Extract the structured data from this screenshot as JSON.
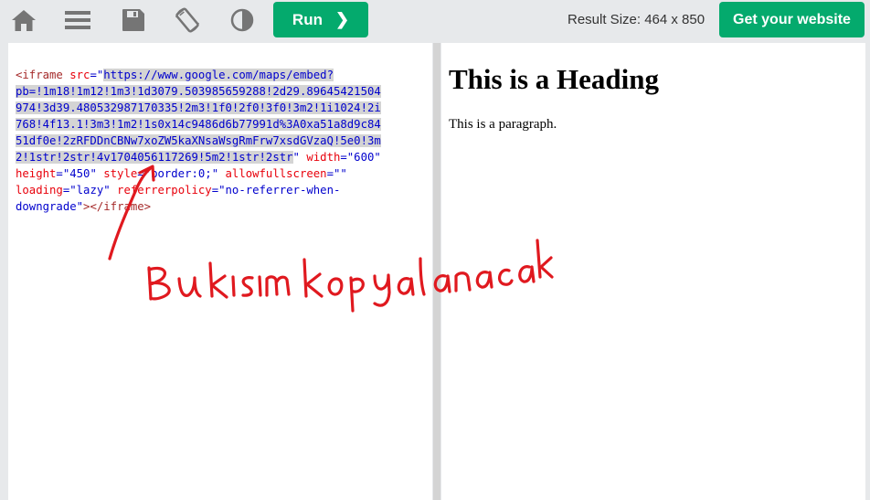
{
  "toolbar": {
    "icons": [
      "home-icon",
      "menu-icon",
      "save-icon",
      "rotate-icon",
      "contrast-icon"
    ],
    "run_label": "Run",
    "run_chevron": "❯",
    "result_size": "Result Size: 464 x 850",
    "get_website_label": "Get your website"
  },
  "code": {
    "lines": [
      [
        {
          "t": "<iframe",
          "c": "tag"
        },
        {
          "t": " src",
          "c": "attr"
        },
        {
          "t": "=\"",
          "c": "val"
        },
        {
          "t": "https://www.google.com/maps/embed?",
          "c": "val",
          "h": true
        }
      ],
      [
        {
          "t": "pb=!1m18!1m12!1m3!1d3079.503985659288!2d29.89645421504",
          "c": "val",
          "h": true
        }
      ],
      [
        {
          "t": "974!3d39.480532987170335!2m3!1f0!2f0!3f0!3m2!1i1024!2i",
          "c": "val",
          "h": true
        }
      ],
      [
        {
          "t": "768!4f13.1!3m3!1m2!1s0x14c9486d6b77991d%3A0xa51a8d9c84",
          "c": "val",
          "h": true
        }
      ],
      [
        {
          "t": "51df0e!2zRFDDnCBNw7xoZW5kaXNsaWsgRmFrw7xsdGVzaQ!5e0!3m",
          "c": "val",
          "h": true
        }
      ],
      [
        {
          "t": "2!1str!2str!4v1704056117269!5m2!1str!2str",
          "c": "val",
          "h": true
        },
        {
          "t": "\"",
          "c": "val"
        },
        {
          "t": " width",
          "c": "attr"
        },
        {
          "t": "=\"600\"",
          "c": "val"
        }
      ],
      [
        {
          "t": "height",
          "c": "attr"
        },
        {
          "t": "=\"450\"",
          "c": "val"
        },
        {
          "t": " style",
          "c": "attr"
        },
        {
          "t": "=\"border:0;\"",
          "c": "val"
        },
        {
          "t": " allowfullscreen",
          "c": "attr"
        },
        {
          "t": "=\"\"",
          "c": "val"
        }
      ],
      [
        {
          "t": "loading",
          "c": "attr"
        },
        {
          "t": "=\"lazy\"",
          "c": "val"
        },
        {
          "t": " referrerpolicy",
          "c": "attr"
        },
        {
          "t": "=\"no-referrer-when-",
          "c": "val"
        }
      ],
      [
        {
          "t": "downgrade\"",
          "c": "val"
        },
        {
          "t": "></iframe>",
          "c": "tag"
        }
      ]
    ]
  },
  "result": {
    "heading": "This is a Heading",
    "paragraph": "This is a paragraph."
  },
  "annotation": {
    "handwritten_note": "Bu kısım kopyalanacak",
    "color": "#e0191f"
  },
  "colors": {
    "accent": "#04aa6d",
    "toolbar_bg": "#e7e9eb",
    "icon_gray": "#757575"
  }
}
